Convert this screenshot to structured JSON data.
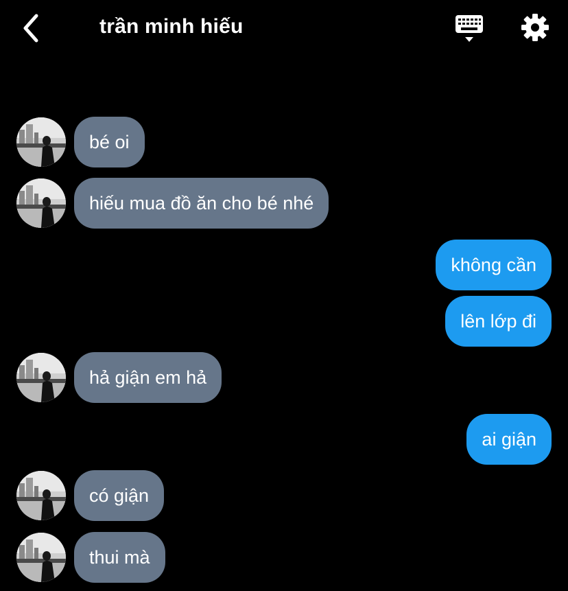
{
  "header": {
    "title": "trần minh hiếu",
    "back_icon": "chevron-left-icon",
    "keyboard_icon": "keyboard-icon",
    "settings_icon": "gear-icon"
  },
  "colors": {
    "background": "#000000",
    "incoming_bubble": "#66768a",
    "outgoing_bubble": "#1d9bf0",
    "text": "#ffffff"
  },
  "messages": [
    {
      "sender": "them",
      "text": "bé oi"
    },
    {
      "sender": "them",
      "text": "hiếu mua đồ ăn cho bé nhé"
    },
    {
      "sender": "me",
      "text": "không cần"
    },
    {
      "sender": "me",
      "text": "lên lớp đi"
    },
    {
      "sender": "them",
      "text": "hả giận em hả"
    },
    {
      "sender": "me",
      "text": "ai giận"
    },
    {
      "sender": "them",
      "text": "có giận"
    },
    {
      "sender": "them",
      "text": "thui mà"
    }
  ]
}
